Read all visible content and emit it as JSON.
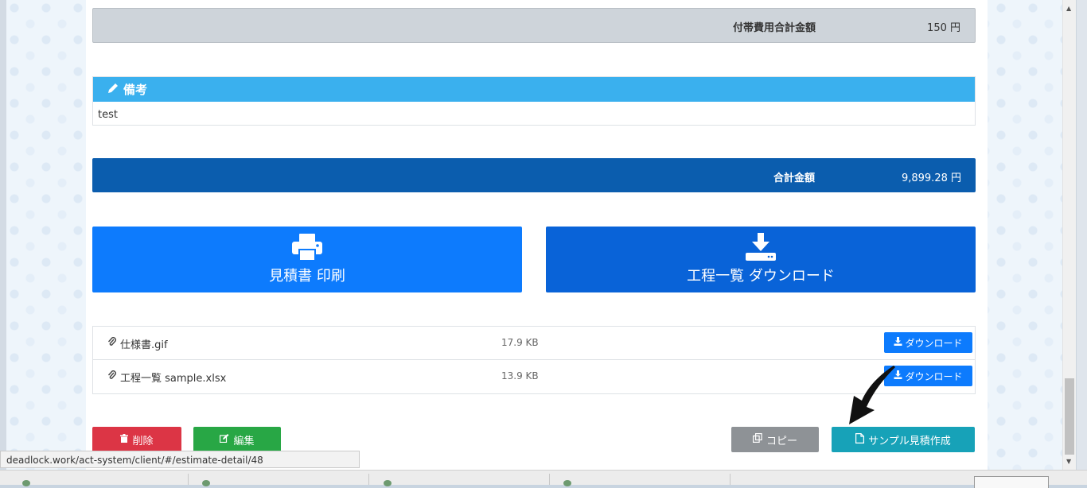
{
  "summary": {
    "fee_total_label": "付帯費用合計金額",
    "fee_total_value": "150 円",
    "grand_total_label": "合計金額",
    "grand_total_value": "9,899.28 円"
  },
  "remarks": {
    "title": "備考",
    "text": "test"
  },
  "actions": {
    "print_label": "見積書 印刷",
    "process_download_label": "工程一覧 ダウンロード",
    "delete_label": "削除",
    "edit_label": "編集",
    "copy_label": "コピー",
    "sample_label": "サンプル見積作成"
  },
  "files": [
    {
      "name": "仕様書.gif",
      "size": "17.9 KB",
      "button": "ダウンロード"
    },
    {
      "name": "工程一覧 sample.xlsx",
      "size": "13.9 KB",
      "button": "ダウンロード"
    }
  ],
  "status_bar": {
    "url": "deadlock.work/act-system/client/#/estimate-detail/48"
  },
  "colors": {
    "remark_header": "#3ab0ee",
    "total_bar": "#0b5dae",
    "print_button": "#0d7bfd",
    "download_button": "#0963d8",
    "delete_button": "#dc3545",
    "edit_button": "#28a745",
    "copy_button": "#8e9296",
    "sample_button": "#17a2b8"
  },
  "icons": {
    "remarks": "pencil-icon",
    "print": "printer-icon",
    "process_download": "download-icon",
    "file": "paperclip-icon",
    "file_download": "download-small-icon",
    "delete": "trash-icon",
    "edit": "edit-icon",
    "copy": "copy-icon",
    "sample": "file-icon",
    "annotation": "curved-arrow-icon"
  }
}
